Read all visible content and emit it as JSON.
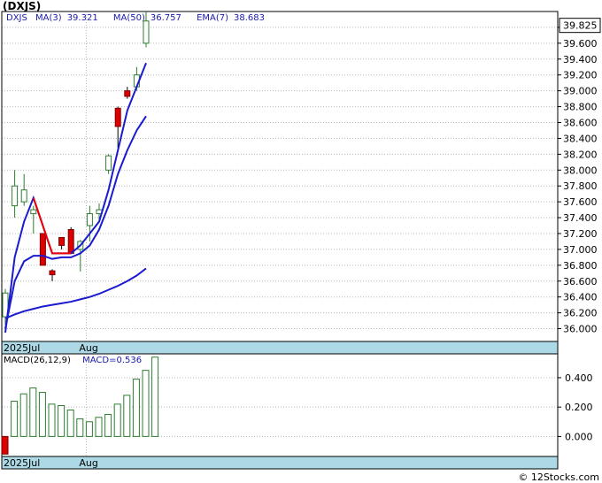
{
  "header": {
    "ticker": "(DXJS)"
  },
  "legend": {
    "symbol": "DXJS",
    "ma3_label": "MA(3)",
    "ma3_value": "39.321",
    "ma50_label": "MA(50)",
    "ma50_value": "36.757",
    "ema7_label": "EMA(7)",
    "ema7_value": "38.683"
  },
  "macd_legend": {
    "label": "MACD(26,12,9)",
    "value_label": "MACD=0.536"
  },
  "credit": "© 12Stocks.com",
  "colors": {
    "up_border": "#2e7d32",
    "down_fill": "#dd0000",
    "line": "#1a1ad0",
    "ema": "#ee0000",
    "axis_band": "#add8e6",
    "hist": "#2e7d32"
  },
  "chart_data": [
    {
      "type": "candlestick",
      "ylim": [
        35.85,
        40.0
      ],
      "y_ticks": [
        "36.000",
        "36.200",
        "36.400",
        "36.600",
        "36.800",
        "37.000",
        "37.200",
        "37.400",
        "37.600",
        "37.800",
        "38.000",
        "38.200",
        "38.400",
        "38.600",
        "38.800",
        "39.000",
        "39.200",
        "39.400",
        "39.600",
        "39.800"
      ],
      "x_labels": [
        {
          "label": "2025Jul",
          "index": 0
        },
        {
          "label": "Aug",
          "index": 9
        }
      ],
      "last_price": "39.825",
      "candles": [
        {
          "o": 36.15,
          "h": 36.5,
          "l": 36.05,
          "c": 36.45
        },
        {
          "o": 37.55,
          "h": 38.0,
          "l": 37.4,
          "c": 37.8
        },
        {
          "o": 37.6,
          "h": 37.95,
          "l": 37.55,
          "c": 37.75
        },
        {
          "o": 37.45,
          "h": 37.55,
          "l": 37.2,
          "c": 37.5
        },
        {
          "o": 37.2,
          "h": 37.2,
          "l": 36.8,
          "c": 36.8
        },
        {
          "o": 36.73,
          "h": 36.75,
          "l": 36.6,
          "c": 36.68
        },
        {
          "o": 37.15,
          "h": 37.15,
          "l": 37.0,
          "c": 37.05
        },
        {
          "o": 37.25,
          "h": 37.28,
          "l": 36.95,
          "c": 36.95
        },
        {
          "o": 37.0,
          "h": 37.12,
          "l": 36.72,
          "c": 37.1
        },
        {
          "o": 37.3,
          "h": 37.55,
          "l": 37.1,
          "c": 37.45
        },
        {
          "o": 37.45,
          "h": 37.58,
          "l": 37.35,
          "c": 37.5
        },
        {
          "o": 38.0,
          "h": 38.2,
          "l": 37.95,
          "c": 38.18
        },
        {
          "o": 38.78,
          "h": 38.8,
          "l": 38.28,
          "c": 38.55
        },
        {
          "o": 39.0,
          "h": 39.05,
          "l": 38.9,
          "c": 38.93
        },
        {
          "o": 39.05,
          "h": 39.3,
          "l": 39.0,
          "c": 39.2
        },
        {
          "o": 39.6,
          "h": 40.0,
          "l": 39.55,
          "c": 39.88
        }
      ],
      "series": [
        {
          "name": "MA(3)",
          "values": [
            35.95,
            36.9,
            37.35,
            37.65,
            37.3,
            36.95,
            36.95,
            36.95,
            37.05,
            37.2,
            37.35,
            37.75,
            38.25,
            38.75,
            39.05,
            39.35
          ]
        },
        {
          "name": "MA(50)",
          "values": [
            36.13,
            36.18,
            36.22,
            36.25,
            36.28,
            36.3,
            36.32,
            36.34,
            36.37,
            36.4,
            36.44,
            36.49,
            36.54,
            36.6,
            36.67,
            36.76
          ]
        },
        {
          "name": "EMA(7)",
          "values": [
            36.0,
            36.6,
            36.85,
            36.92,
            36.92,
            36.88,
            36.9,
            36.9,
            36.95,
            37.05,
            37.25,
            37.55,
            37.95,
            38.25,
            38.5,
            38.68
          ]
        }
      ],
      "ema_red_range": [
        3,
        7
      ]
    },
    {
      "type": "bar",
      "ylim": [
        -0.12,
        0.58
      ],
      "y_ticks": [
        "0.000",
        "0.200",
        "0.400"
      ],
      "x_labels": [
        {
          "label": "2025Jul",
          "index": 0
        },
        {
          "label": "Aug",
          "index": 9
        }
      ],
      "values": [
        -0.12,
        0.24,
        0.29,
        0.33,
        0.3,
        0.22,
        0.21,
        0.18,
        0.12,
        0.1,
        0.13,
        0.15,
        0.22,
        0.28,
        0.39,
        0.45,
        0.54
      ]
    }
  ]
}
